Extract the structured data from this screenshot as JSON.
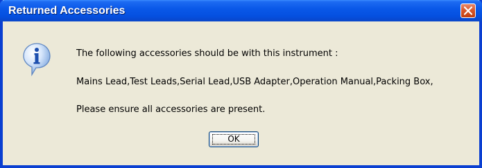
{
  "dialog": {
    "title": "Returned Accessories",
    "icon": "info-icon",
    "messages": [
      "The following accessories should be with this instrument :",
      "Mains Lead,Test Leads,Serial Lead,USB Adapter,Operation Manual,Packing Box,",
      "Please ensure all accessories are present."
    ],
    "ok_label": "OK",
    "close_icon": "close-icon"
  },
  "colors": {
    "titlebar": "#0a58e8",
    "window_face": "#ece9d8",
    "close_button": "#d8582c"
  }
}
